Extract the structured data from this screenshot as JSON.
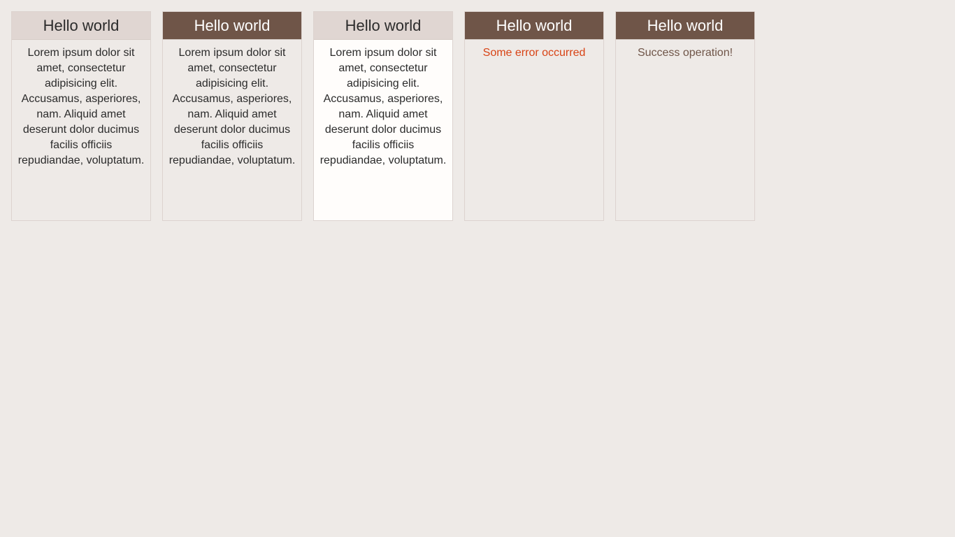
{
  "cards": [
    {
      "title": "Hello world",
      "body": "Lorem ipsum dolor sit amet, consectetur adipisicing elit. Accusamus, asperiores, nam. Aliquid amet deserunt dolor ducimus facilis officiis repudiandae, voluptatum."
    },
    {
      "title": "Hello world",
      "body": "Lorem ipsum dolor sit amet, consectetur adipisicing elit. Accusamus, asperiores, nam. Aliquid amet deserunt dolor ducimus facilis officiis repudiandae, voluptatum."
    },
    {
      "title": "Hello world",
      "body": "Lorem ipsum dolor sit amet, consectetur adipisicing elit. Accusamus, asperiores, nam. Aliquid amet deserunt dolor ducimus facilis officiis repudiandae, voluptatum."
    },
    {
      "title": "Hello world",
      "body": "Some error occurred"
    },
    {
      "title": "Hello world",
      "body": "Success operation!"
    }
  ],
  "colors": {
    "background": "#eeeae7",
    "header_light": "#e0d6d2",
    "header_dark": "#6f5548",
    "error_text": "#d84315",
    "success_text": "#6f5548"
  }
}
